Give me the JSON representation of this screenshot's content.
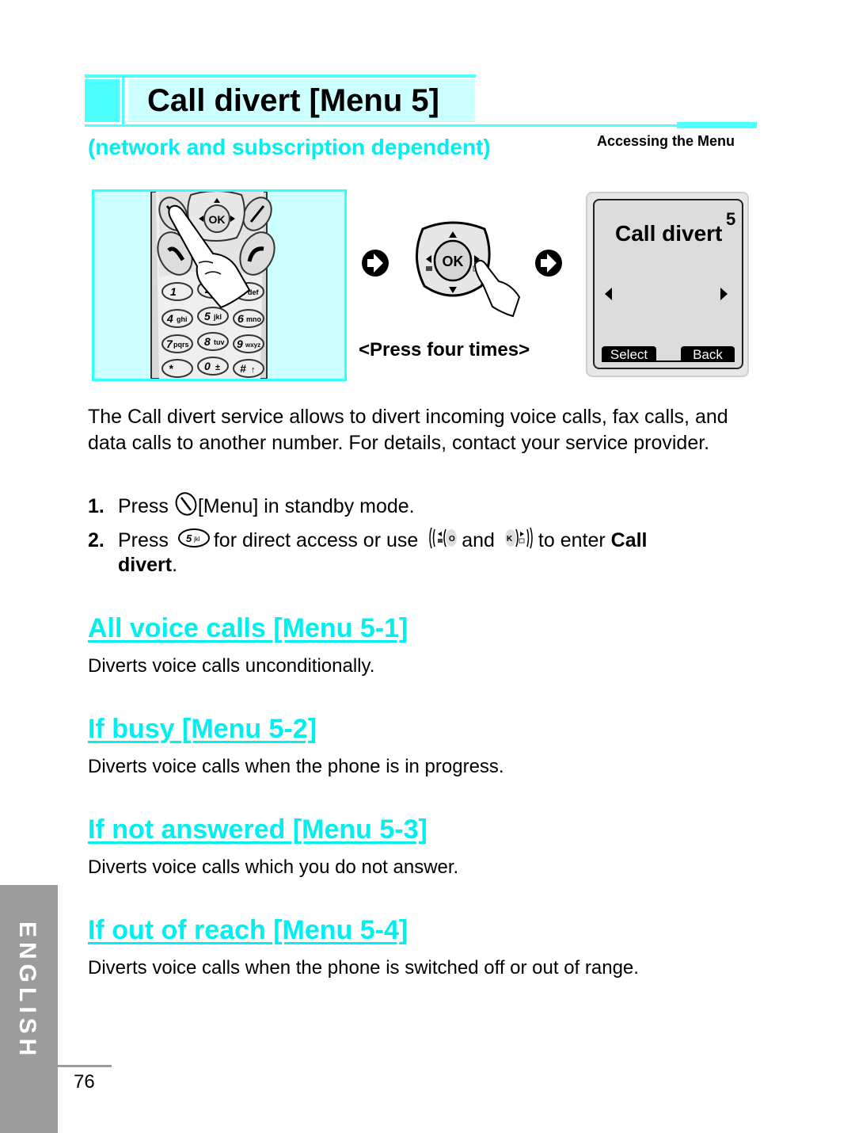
{
  "header": {
    "title": "Call divert [Menu 5]",
    "subtitle": "(network and subscription dependent)",
    "section_label": "Accessing the Menu"
  },
  "illustration": {
    "keypad_keys": [
      {
        "num": "1",
        "sub": "••"
      },
      {
        "num": "2",
        "sub": "abc"
      },
      {
        "num": "3",
        "sub": "def"
      },
      {
        "num": "4",
        "sub": "ghi"
      },
      {
        "num": "5",
        "sub": "jkl"
      },
      {
        "num": "6",
        "sub": "mno"
      },
      {
        "num": "7",
        "sub": "pqrs"
      },
      {
        "num": "8",
        "sub": "tuv"
      },
      {
        "num": "9",
        "sub": "wxyz"
      },
      {
        "num": "*",
        "sub": "•,"
      },
      {
        "num": "0",
        "sub": "±"
      },
      {
        "num": "#",
        "sub": "↑"
      }
    ],
    "ok_label": "OK",
    "press_note": "<Press four times>",
    "screen": {
      "title": "Call divert",
      "menu_number": "5",
      "left_soft_key": "Select",
      "right_soft_key": "Back"
    }
  },
  "intro": "The Call divert service allows to divert incoming voice calls, fax calls, and data calls to another number. For details, contact your service provider.",
  "steps": [
    {
      "num": "1.",
      "parts": [
        "Press",
        "[Menu] in standby mode."
      ]
    },
    {
      "num": "2.",
      "parts": [
        "Press",
        "for direct access or use",
        "and",
        "to enter",
        "Call",
        "divert",
        "."
      ],
      "key_label": "5",
      "key_sub": "jkl"
    }
  ],
  "sections": [
    {
      "heading": "All voice calls [Menu 5-1]",
      "description": "Diverts voice calls unconditionally."
    },
    {
      "heading": "If busy [Menu 5-2]",
      "description": "Diverts voice calls when the phone is in progress."
    },
    {
      "heading": "If not answered [Menu 5-3]",
      "description": "Diverts voice calls which you do not answer."
    },
    {
      "heading": "If out of reach [Menu 5-4]",
      "description": "Diverts voice calls when the phone is switched off or out of range."
    }
  ],
  "footer": {
    "language_tab": "ENGLISH",
    "page_number": "76"
  },
  "colors": {
    "accent": "#00f0f0",
    "accent_light": "#ccffff",
    "tab_gray": "#9c9c9c"
  }
}
